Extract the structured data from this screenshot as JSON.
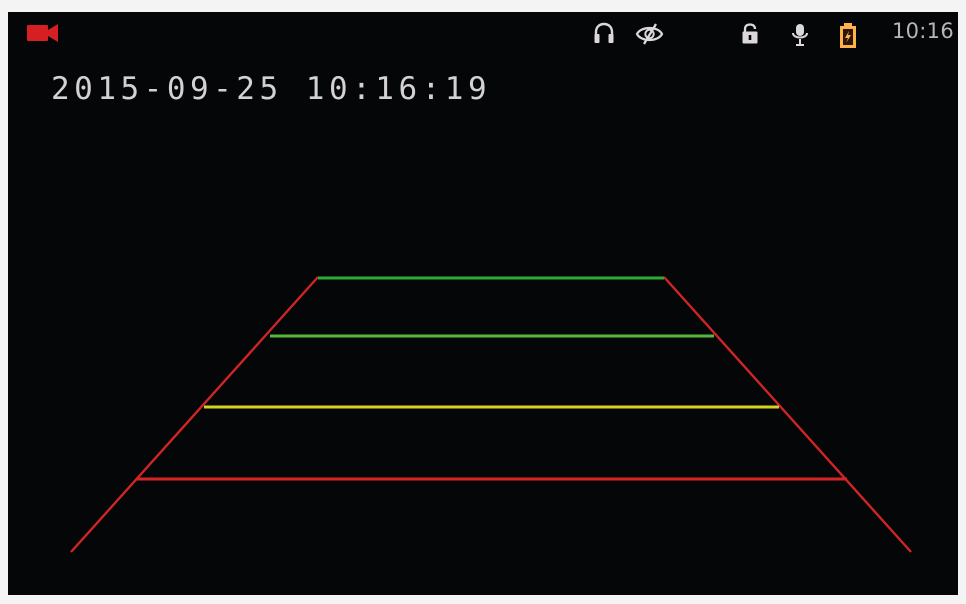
{
  "status_bar": {
    "recording_icon": "video-camera-icon",
    "headphones_icon": "headphones-icon",
    "eye_off_icon": "eye-off-icon",
    "lock_icon": "lock-icon",
    "microphone_icon": "microphone-icon",
    "battery_icon": "battery-icon",
    "time": "10:16"
  },
  "overlay": {
    "timestamp": "2015-09-25 10:16:19"
  },
  "colors": {
    "background": "#050607",
    "recording": "#d51f22",
    "status_icons": "#dcd7d8",
    "battery": "#ffb24a",
    "guide_far": "#2eaa3b",
    "guide_mid": "#d4d41f",
    "guide_near": "#d62424",
    "guide_edges": "#cf2525"
  }
}
